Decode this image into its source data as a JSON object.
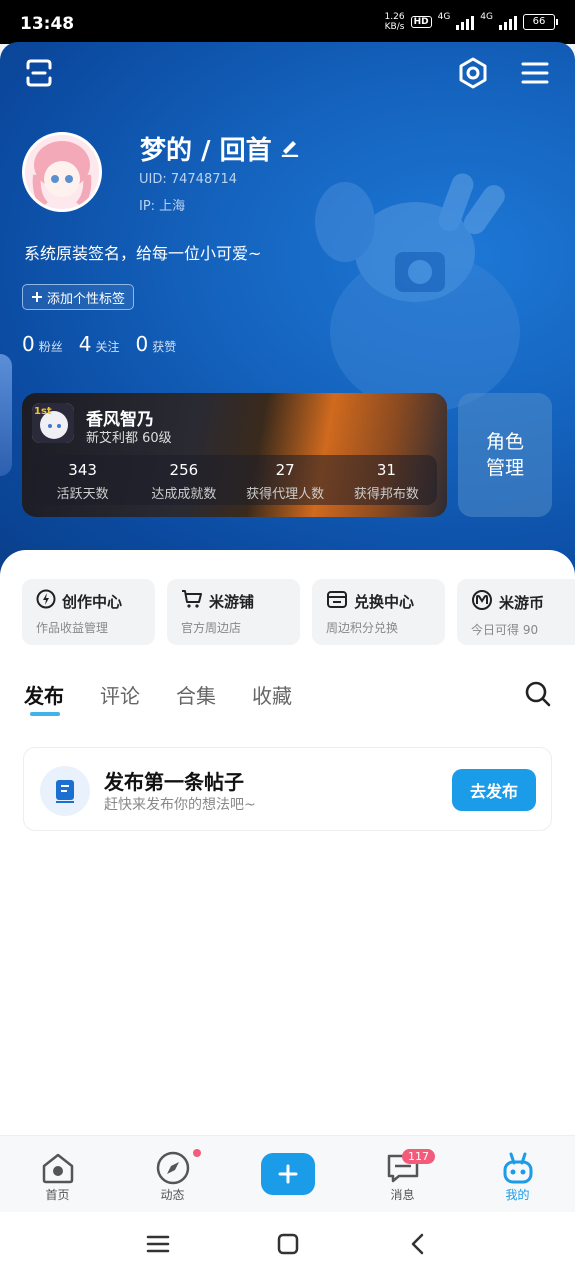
{
  "status_bar": {
    "time": "13:48",
    "speed_value": "1.26",
    "speed_unit": "KB/s",
    "hd": "HD",
    "net1": "4G",
    "net2": "4G",
    "battery": "66"
  },
  "profile": {
    "nickname": "梦的 / 回首",
    "uid": "UID: 74748714",
    "ip": "IP: 上海",
    "signature": "系统原装签名，给每一位小可爱~",
    "add_tag": "添加个性标签",
    "stats": [
      {
        "num": "0",
        "label": "粉丝"
      },
      {
        "num": "4",
        "label": "关注"
      },
      {
        "num": "0",
        "label": "获赞"
      }
    ]
  },
  "game_card": {
    "name": "香风智乃",
    "server": "新艾利都 60级",
    "stats": [
      {
        "value": "343",
        "label": "活跃天数"
      },
      {
        "value": "256",
        "label": "达成成就数"
      },
      {
        "value": "27",
        "label": "获得代理人数"
      },
      {
        "value": "31",
        "label": "获得邦布数"
      }
    ],
    "role_button": "角色\n管理"
  },
  "shortcuts": [
    {
      "title": "创作中心",
      "sub": "作品收益管理",
      "icon": "lightning-icon"
    },
    {
      "title": "米游铺",
      "sub": "官方周边店",
      "icon": "cart-icon"
    },
    {
      "title": "兑换中心",
      "sub": "周边积分兑换",
      "icon": "shop-icon"
    },
    {
      "title": "米游币",
      "sub": "今日可得 90",
      "icon": "coin-icon"
    }
  ],
  "tabs": [
    "发布",
    "评论",
    "合集",
    "收藏"
  ],
  "active_tab": "发布",
  "post_prompt": {
    "title": "发布第一条帖子",
    "subtitle": "赶快来发布你的想法吧~",
    "button": "去发布"
  },
  "bottom_nav": [
    {
      "label": "首页",
      "icon": "home-icon"
    },
    {
      "label": "动态",
      "icon": "compass-icon"
    },
    {
      "label": "",
      "icon": "plus-icon"
    },
    {
      "label": "消息",
      "icon": "message-icon"
    },
    {
      "label": "我的",
      "icon": "mascot-icon"
    }
  ],
  "message_badge": "117",
  "colors": {
    "accent": "#1a9ce8",
    "header_blue": "#1565c0",
    "badge": "#f45b7a"
  }
}
